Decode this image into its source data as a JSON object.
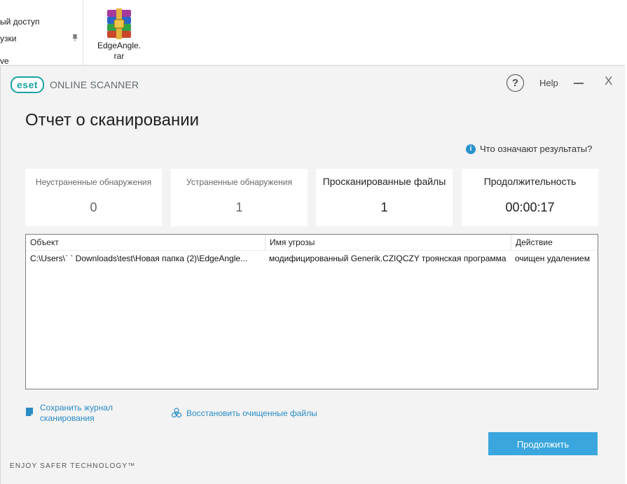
{
  "explorer": {
    "sidebar_items": [
      "ый доступ",
      "узки",
      "ve"
    ],
    "file": {
      "name_line1": "EdgeAngle.",
      "name_line2": "rar",
      "icon": "winrar-archive-icon"
    }
  },
  "window": {
    "logo_badge": "eset",
    "product": "ONLINE SCANNER",
    "help_label": "Help",
    "help_glyph": "?",
    "close_glyph": "X"
  },
  "report": {
    "title": "Отчет о сканировании",
    "results_help": "Что означают результаты?",
    "stats": [
      {
        "label": "Неустраненные обнаружения",
        "value": "0"
      },
      {
        "label": "Устраненные обнаружения",
        "value": "1"
      },
      {
        "label": "Просканированные файлы",
        "value": "1"
      },
      {
        "label": "Продолжительность",
        "value": "00:00:17"
      }
    ],
    "table": {
      "columns": [
        "Объект",
        "Имя угрозы",
        "Действие"
      ],
      "rows": [
        {
          "object": "C:\\Users\\`   `   Downloads\\test\\Новая папка (2)\\EdgeAngle...",
          "threat": "модифицированный Generik.CZIQCZY троянская программа",
          "action": "очищен удалением"
        }
      ]
    },
    "save_log_line1": "Сохранить журнал",
    "save_log_line2": "сканирования",
    "restore": "Восстановить очищенные файлы",
    "continue": "Продолжить",
    "tagline": "ENJOY SAFER TECHNOLOGY™"
  },
  "colors": {
    "accent": "#3aa6dd",
    "brand_teal": "#1aa3a3",
    "link": "#2a8cc6",
    "window_bg": "#f3f3f3"
  }
}
